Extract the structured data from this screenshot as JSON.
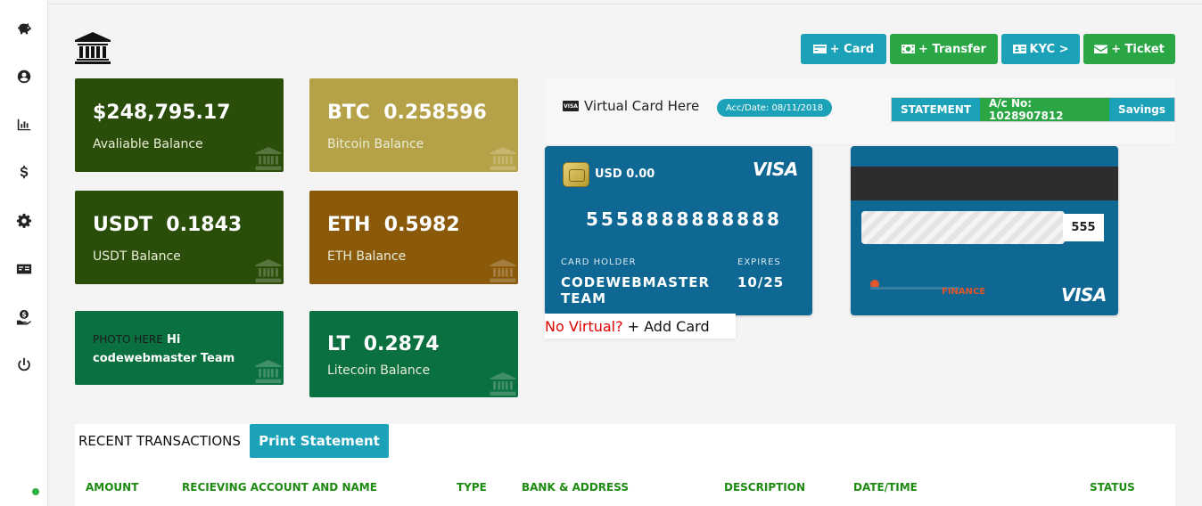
{
  "sidebar": {
    "icons": [
      "piggy-bank-icon",
      "user-circle-icon",
      "chart-bar-icon",
      "dollar-icon",
      "gear-icon",
      "money-check-icon",
      "hand-coin-icon",
      "power-icon"
    ]
  },
  "toolbar": {
    "card_label": "+ Card",
    "transfer_label": "+ Transfer",
    "kyc_label": "KYC >",
    "ticket_label": "+ Ticket"
  },
  "balances": {
    "available": {
      "amount": "$248,795.17",
      "label": "Avaliable Balance",
      "color": "#2a4e0a"
    },
    "btc": {
      "amount": "BTC  0.258596",
      "label": "Bitcoin Balance",
      "color": "#b5a147"
    },
    "usdt": {
      "amount": "USDT  0.1843",
      "label": "USDT Balance",
      "color": "#2a4e0a"
    },
    "eth": {
      "amount": "ETH  0.5982",
      "label": "ETH Balance",
      "color": "#8a5a0a"
    },
    "profile": {
      "photo_text": "PHOTO HERE",
      "greeting": "Hi",
      "name": "codewebmaster Team",
      "color": "#0b7040"
    },
    "lt": {
      "amount": "LT  0.2874",
      "label": "Litecoin Balance",
      "color": "#0b7040"
    }
  },
  "virtual_card": {
    "title": "Virtual Card Here",
    "acc_date": "Acc/Date: 08/11/2018",
    "statement_label": "STATEMENT",
    "account_no": "A/c No: 1028907812",
    "account_type": "Savings"
  },
  "card_front": {
    "balance": "USD 0.00",
    "brand": "VISA",
    "number": "5558888888888",
    "holder_label": "CARD HOLDER",
    "holder_name": "CODEWEBMASTER TEAM",
    "expires_label": "EXPIRES",
    "expires": "10/25"
  },
  "card_back": {
    "cvv": "555",
    "bank_name": "FINANCE",
    "brand": "VISA"
  },
  "no_virtual": {
    "prompt": "No Virtual?",
    "action": "+ Add Card"
  },
  "transactions": {
    "title": "RECENT TRANSACTIONS",
    "print_label": "Print Statement",
    "headers": [
      "AMOUNT",
      "RECIEVING ACCOUNT AND NAME",
      "TYPE",
      "BANK & ADDRESS",
      "DESCRIPTION",
      "DATE/TIME",
      "STATUS"
    ]
  },
  "colors": {
    "teal": "#1ba2b8",
    "green": "#2aa744",
    "card_blue": "#0e6893",
    "header_green": "#1e8a12"
  }
}
